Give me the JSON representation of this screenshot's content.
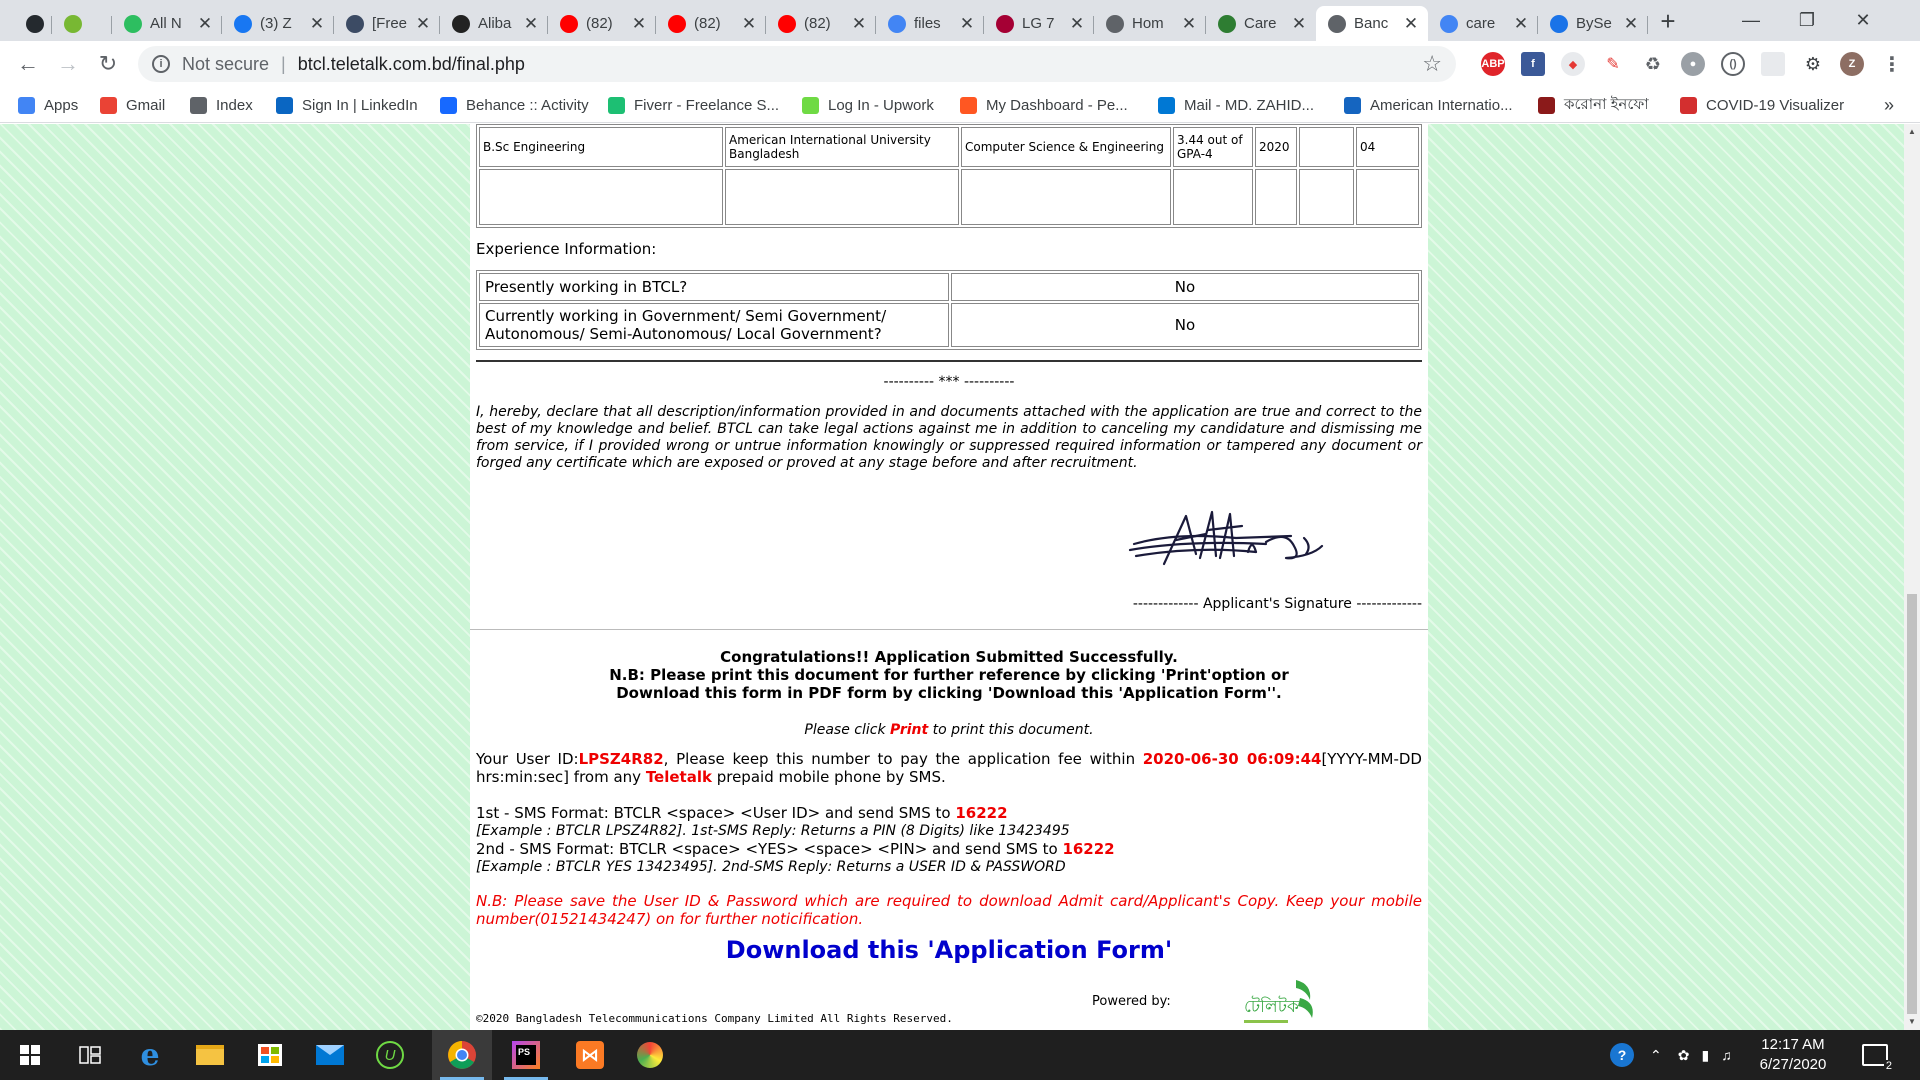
{
  "browser": {
    "tabs": [
      {
        "title": "",
        "icon": "github-icon",
        "color": "#24292e"
      },
      {
        "title": "",
        "icon": "utorrent-icon",
        "color": "#78b833"
      },
      {
        "title": "All N",
        "icon": "evernote-icon",
        "color": "#2dbe60"
      },
      {
        "title": "(3) Z",
        "icon": "facebook-icon",
        "color": "#1877f2"
      },
      {
        "title": "[Free",
        "icon": "elementor-icon",
        "color": "#3c4b64"
      },
      {
        "title": "Aliba",
        "icon": "alibaba-icon",
        "color": "#222222"
      },
      {
        "title": "(82)",
        "icon": "youtube-icon",
        "color": "#ff0000"
      },
      {
        "title": "(82)",
        "icon": "youtube-icon",
        "color": "#ff0000"
      },
      {
        "title": "(82)",
        "icon": "youtube-icon",
        "color": "#ff0000"
      },
      {
        "title": "files",
        "icon": "google-icon",
        "color": "#4285f4"
      },
      {
        "title": "LG 7",
        "icon": "lg-icon",
        "color": "#a50034"
      },
      {
        "title": "Hom",
        "icon": "globe-icon",
        "color": "#5f6368"
      },
      {
        "title": "Care",
        "icon": "aiub-icon",
        "color": "#2e7d32"
      },
      {
        "title": "Banc",
        "icon": "globe-icon",
        "color": "#5f6368"
      },
      {
        "title": "care",
        "icon": "google-icon",
        "color": "#4285f4"
      },
      {
        "title": "BySe",
        "icon": "globe-icon",
        "color": "#1a73e8"
      }
    ],
    "address": {
      "security_label": "Not secure",
      "url": "btcl.teletalk.com.bd/final.php"
    },
    "bookmarks": [
      {
        "label": "Apps",
        "icon": "apps-grid-icon",
        "color": "#4285f4"
      },
      {
        "label": "Gmail",
        "icon": "gmail-icon",
        "color": "#ea4335"
      },
      {
        "label": "Index",
        "icon": "globe-icon",
        "color": "#5f6368"
      },
      {
        "label": "Sign In | LinkedIn",
        "icon": "linkedin-icon",
        "color": "#0a66c2"
      },
      {
        "label": "Behance :: Activity",
        "icon": "behance-icon",
        "color": "#1769ff"
      },
      {
        "label": "Fiverr - Freelance S...",
        "icon": "fiverr-icon",
        "color": "#1dbf73"
      },
      {
        "label": "Log In - Upwork",
        "icon": "upwork-icon",
        "color": "#6fda44"
      },
      {
        "label": "My Dashboard - Pe...",
        "icon": "dashboard-icon",
        "color": "#ff5722"
      },
      {
        "label": "Mail - MD. ZAHID...",
        "icon": "outlook-icon",
        "color": "#0078d4"
      },
      {
        "label": "American Internatio...",
        "icon": "aiub-icon",
        "color": "#1565c0"
      },
      {
        "label": "করোনা ইনফো",
        "icon": "corona-info-icon",
        "color": "#8b1a1a"
      },
      {
        "label": "COVID-19 Visualizer",
        "icon": "covid-icon",
        "color": "#d32f2f"
      }
    ],
    "bookmarks_overflow": "»"
  },
  "page": {
    "education": {
      "row": {
        "degree": "B.Sc Engineering",
        "institute": "American International University Bangladesh",
        "subject": "Computer Science & Engineering",
        "result": "3.44 out of GPA-4",
        "year": "2020",
        "col6": "",
        "duration": "04"
      }
    },
    "experience": {
      "title": "Experience Information:",
      "rows": [
        {
          "q": "Presently working in BTCL?",
          "a": "No"
        },
        {
          "q": "Currently working in Government/ Semi Government/ Autonomous/ Semi-Autonomous/ Local Government?",
          "a": "No"
        }
      ]
    },
    "separator": "---------- *** ----------",
    "declaration": "I, hereby, declare that all description/information provided in and documents attached with the application are true and correct to the best of my knowledge and belief. BTCL can take legal actions against me in addition to canceling my candidature and dismissing me from service, if I provided wrong or untrue information knowingly or suppressed required information or tampered any document or forged any certificate which are exposed or proved at any stage before and after recruitment.",
    "signature_label": "------------- Applicant's Signature -------------",
    "congrats": {
      "line1": "Congratulations!! Application Submitted Successfully.",
      "line2": "N.B: Please print this document for further reference by clicking 'Print'option or",
      "line3": "Download this form in PDF form by clicking 'Download this 'Application Form''."
    },
    "print_note": {
      "before": "Please click ",
      "link": "Print",
      "after": " to print this document."
    },
    "user_id": {
      "prefix": "Your User ID:",
      "id": "LPSZ4R82",
      "middle": ", Please keep this number to pay the application fee within ",
      "deadline": "2020-06-30 06:09:44",
      "format": "[YYYY-MM-DD hrs:min:sec] from any ",
      "operator": "Teletalk",
      "suffix": " prepaid mobile phone by SMS."
    },
    "sms": {
      "first": "1st - SMS Format: BTCLR <space> <User ID> and send SMS to ",
      "first_number": "16222",
      "first_example": "[Example : BTCLR LPSZ4R82]. 1st-SMS Reply: Returns a PIN (8 Digits) like 13423495",
      "second": "2nd - SMS Format: BTCLR <space> <YES> <space> <PIN> and send SMS to ",
      "second_number": "16222",
      "second_example": "[Example : BTCLR YES 13423495]. 2nd-SMS Reply: Returns a USER ID & PASSWORD"
    },
    "nb_save": "N.B: Please save the User ID & Password which are required to download Admit card/Applicant's Copy. Keep your mobile number(01521434247) on for further noticification.",
    "download_link": "Download this 'Application Form'",
    "powered_by": "Powered by:",
    "copyright": "©2020 Bangladesh Telecommunications Company Limited All Rights Reserved.",
    "logo_text": "টেলিটক"
  },
  "taskbar": {
    "clock_time": "12:17 AM",
    "clock_date": "6/27/2020",
    "notification_count": "2"
  }
}
